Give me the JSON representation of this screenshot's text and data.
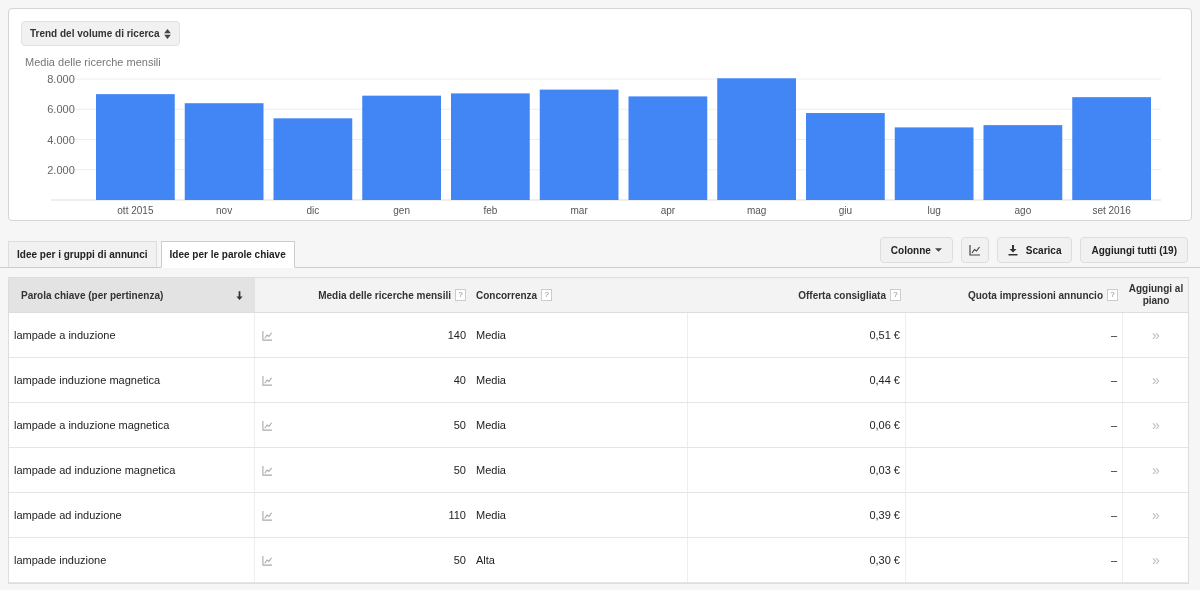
{
  "chart_panel": {
    "metric_selector": "Trend del volume di ricerca",
    "chart_data": {
      "type": "bar",
      "ylabel": "Media delle ricerche mensili",
      "categories": [
        "ott 2015",
        "nov",
        "dic",
        "gen",
        "feb",
        "mar",
        "apr",
        "mag",
        "giu",
        "lug",
        "ago",
        "set 2016"
      ],
      "grid": true,
      "series": [
        {
          "color": "#4285f4",
          "values": [
            7000,
            6400,
            5400,
            6900,
            7050,
            7300,
            6850,
            8050,
            5750,
            4800,
            4950,
            6800
          ]
        }
      ],
      "ylim": [
        0,
        8200
      ],
      "yticks": [
        {
          "value": 2000,
          "label": "2.000"
        },
        {
          "value": 4000,
          "label": "4.000"
        },
        {
          "value": 6000,
          "label": "6.000"
        },
        {
          "value": 8000,
          "label": "8.000"
        }
      ]
    }
  },
  "tabs": [
    {
      "label": "Idee per i gruppi di annunci",
      "selected": false
    },
    {
      "label": "Idee per le parole chiave",
      "selected": true
    }
  ],
  "toolbar": {
    "columns_button": "Colonne",
    "download_button": "Scarica",
    "add_all_button": "Aggiungi tutti (19)"
  },
  "table": {
    "columns": [
      {
        "label": "Parola chiave (per pertinenza)",
        "sorted": true
      },
      {
        "label": "Media delle ricerche mensili",
        "help": "?"
      },
      {
        "label": "Concorrenza",
        "help": "?"
      },
      {
        "label": "Offerta consigliata",
        "help": "?"
      },
      {
        "label": "Quota impressioni annuncio",
        "help": "?"
      },
      {
        "label": "Aggiungi al piano"
      }
    ],
    "rows": [
      {
        "keyword": "lampade a induzione",
        "searches": "140",
        "competition": "Media",
        "bid": "0,51 €",
        "share": "–",
        "add": "»"
      },
      {
        "keyword": "lampade induzione magnetica",
        "searches": "40",
        "competition": "Media",
        "bid": "0,44 €",
        "share": "–",
        "add": "»"
      },
      {
        "keyword": "lampade a induzione magnetica",
        "searches": "50",
        "competition": "Media",
        "bid": "0,06 €",
        "share": "–",
        "add": "»"
      },
      {
        "keyword": "lampade ad induzione magnetica",
        "searches": "50",
        "competition": "Media",
        "bid": "0,03 €",
        "share": "–",
        "add": "»"
      },
      {
        "keyword": "lampade ad induzione",
        "searches": "110",
        "competition": "Media",
        "bid": "0,39 €",
        "share": "–",
        "add": "»"
      },
      {
        "keyword": "lampade induzione",
        "searches": "50",
        "competition": "Alta",
        "bid": "0,30 €",
        "share": "–",
        "add": "»"
      }
    ]
  }
}
